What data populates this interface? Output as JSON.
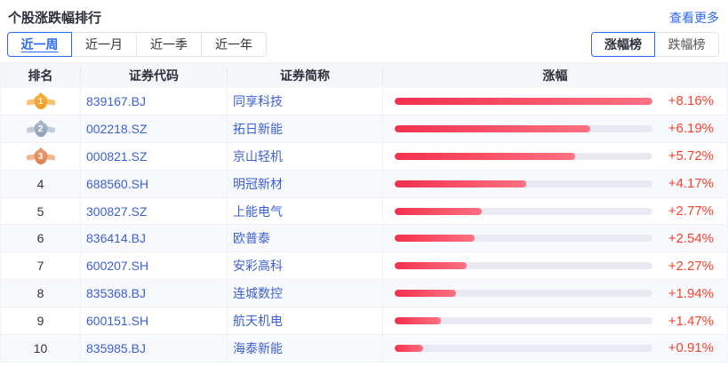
{
  "header": {
    "title": "个股涨跌幅排行",
    "more_link": "查看更多"
  },
  "tabs": {
    "items": [
      {
        "label": "近一周",
        "active": true
      },
      {
        "label": "近一月",
        "active": false
      },
      {
        "label": "近一季",
        "active": false
      },
      {
        "label": "近一年",
        "active": false
      }
    ]
  },
  "toggles": {
    "gainers": "涨幅榜",
    "losers": "跌幅榜"
  },
  "table": {
    "headers": {
      "rank": "排名",
      "code": "证券代码",
      "name": "证券简称",
      "change": "涨幅"
    },
    "max_value": 8.16,
    "rows": [
      {
        "rank": "1",
        "medal": "gold",
        "code": "839167.BJ",
        "name": "同享科技",
        "value": 8.16,
        "change": "+8.16%"
      },
      {
        "rank": "2",
        "medal": "silver",
        "code": "002218.SZ",
        "name": "拓日新能",
        "value": 6.19,
        "change": "+6.19%"
      },
      {
        "rank": "3",
        "medal": "bronze",
        "code": "000821.SZ",
        "name": "京山轻机",
        "value": 5.72,
        "change": "+5.72%"
      },
      {
        "rank": "4",
        "medal": null,
        "code": "688560.SH",
        "name": "明冠新材",
        "value": 4.17,
        "change": "+4.17%"
      },
      {
        "rank": "5",
        "medal": null,
        "code": "300827.SZ",
        "name": "上能电气",
        "value": 2.77,
        "change": "+2.77%"
      },
      {
        "rank": "6",
        "medal": null,
        "code": "836414.BJ",
        "name": "欧普泰",
        "value": 2.54,
        "change": "+2.54%"
      },
      {
        "rank": "7",
        "medal": null,
        "code": "600207.SH",
        "name": "安彩高科",
        "value": 2.27,
        "change": "+2.27%"
      },
      {
        "rank": "8",
        "medal": null,
        "code": "835368.BJ",
        "name": "连城数控",
        "value": 1.94,
        "change": "+1.94%"
      },
      {
        "rank": "9",
        "medal": null,
        "code": "600151.SH",
        "name": "航天机电",
        "value": 1.47,
        "change": "+1.47%"
      },
      {
        "rank": "10",
        "medal": null,
        "code": "835985.BJ",
        "name": "海泰新能",
        "value": 0.91,
        "change": "+0.91%"
      }
    ]
  },
  "chart_data": {
    "type": "bar",
    "categories": [
      "同享科技",
      "拓日新能",
      "京山轻机",
      "明冠新材",
      "上能电气",
      "欧普泰",
      "安彩高科",
      "连城数控",
      "航天机电",
      "海泰新能"
    ],
    "values": [
      8.16,
      6.19,
      5.72,
      4.17,
      2.77,
      2.54,
      2.27,
      1.94,
      1.47,
      0.91
    ],
    "title": "个股涨跌幅排行 - 近一周涨幅榜",
    "xlabel": "涨幅 (%)",
    "ylabel": "",
    "xlim": [
      0,
      8.16
    ]
  },
  "colors": {
    "accent_blue": "#2c68f6",
    "link_blue": "#3c60d2",
    "change_red": "#f9422e",
    "bar_gradient_start": "#f3304d",
    "bar_gradient_end": "#ff7181",
    "bar_track": "#e8e9f3",
    "header_bg": "#f5f6fa",
    "alt_row_bg": "#f8f9fc"
  }
}
